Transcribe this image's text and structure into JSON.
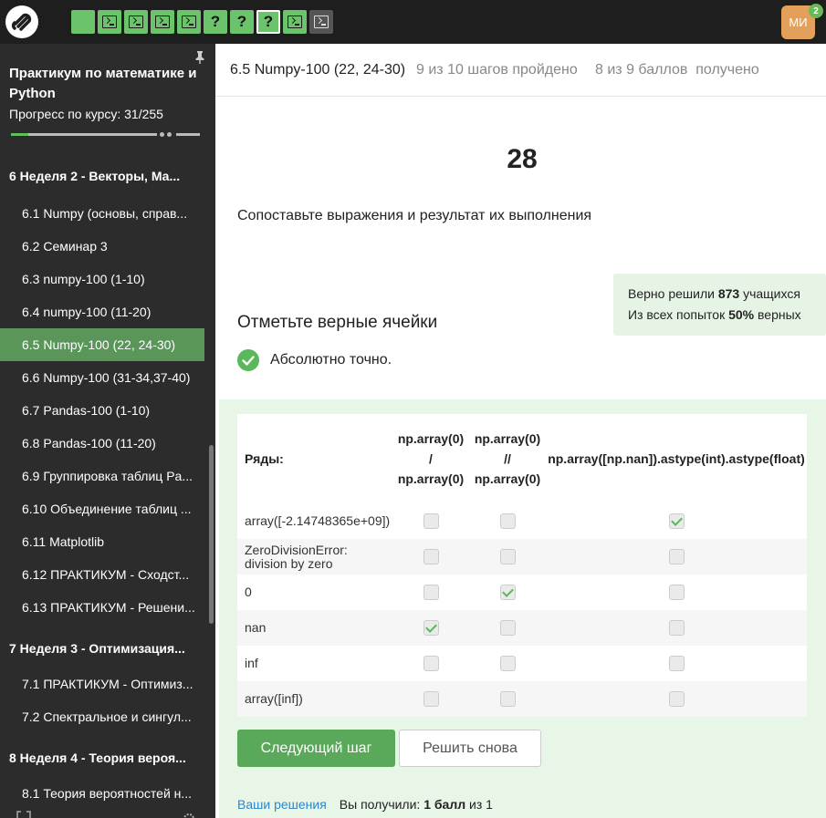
{
  "topbar": {
    "steps": [
      {
        "kind": "text",
        "state": "done",
        "glyph": ""
      },
      {
        "kind": "code",
        "state": "done",
        "glyph": ""
      },
      {
        "kind": "code",
        "state": "done",
        "glyph": ""
      },
      {
        "kind": "code",
        "state": "done",
        "glyph": ""
      },
      {
        "kind": "code",
        "state": "done",
        "glyph": ""
      },
      {
        "kind": "quiz",
        "state": "done",
        "glyph": "?"
      },
      {
        "kind": "quiz",
        "state": "done",
        "glyph": "?"
      },
      {
        "kind": "quiz",
        "state": "current",
        "glyph": "?"
      },
      {
        "kind": "code",
        "state": "done",
        "glyph": ""
      },
      {
        "kind": "code",
        "state": "pending",
        "glyph": ""
      }
    ],
    "avatar_initials": "МИ",
    "notification_count": "2",
    "colors": {
      "step_done": "#6bc36b",
      "step_pending": "#555555",
      "avatar": "#e3a05a"
    }
  },
  "sidebar": {
    "course_title": "Практикум по математике и Python",
    "progress_label": "Прогресс по курсу:  31/255",
    "progress_fraction": 0.1216,
    "sections": [
      {
        "title": "6  Неделя 2 - Векторы, Ма...",
        "items": [
          {
            "label": "6.1  Numpy (основы, справ..."
          },
          {
            "label": "6.2  Семинар 3"
          },
          {
            "label": "6.3  numpy-100 (1-10)"
          },
          {
            "label": "6.4  numpy-100 (11-20)"
          },
          {
            "label": "6.5  Numpy-100 (22, 24-30)",
            "active": true
          },
          {
            "label": "6.6  Numpy-100 (31-34,37-40)"
          },
          {
            "label": "6.7  Pandas-100 (1-10)"
          },
          {
            "label": "6.8  Pandas-100 (11-20)"
          },
          {
            "label": "6.9  Группировка таблиц Pa..."
          },
          {
            "label": "6.10  Объединение таблиц ..."
          },
          {
            "label": "6.11  Matplotlib"
          },
          {
            "label": "6.12  ПРАКТИКУМ - Сходст..."
          },
          {
            "label": "6.13  ПРАКТИКУМ - Решени..."
          }
        ]
      },
      {
        "title": "7  Неделя 3 - Оптимизация...",
        "items": [
          {
            "label": "7.1  ПРАКТИКУМ - Оптимиз..."
          },
          {
            "label": "7.2  Спектральное и сингул..."
          }
        ]
      },
      {
        "title": "8  Неделя 4 - Теория вероя...",
        "items": [
          {
            "label": "8.1  Теория вероятностей н..."
          }
        ]
      }
    ],
    "active_color": "#5a965a"
  },
  "header": {
    "lesson": "6.5 Numpy-100 (22, 24-30)",
    "steps_done": "9 из 10 шагов пройдено",
    "score": "8 из 9 баллов  получено"
  },
  "step": {
    "number": "28",
    "question": "Сопоставьте выражения и результат их выполнения",
    "stats": {
      "solved_prefix": "Верно решили ",
      "solved_count": "873",
      "solved_suffix": " учащихся",
      "attempts_prefix": "Из всех попыток ",
      "attempts_pct": "50%",
      "attempts_suffix": " верных"
    },
    "subtitle": "Отметьте верные ячейки",
    "verdict": "Абсолютно точно."
  },
  "matrix": {
    "row_header": "Ряды:",
    "columns": [
      {
        "lines": [
          "np.array(0)",
          "/",
          "np.array(0)"
        ]
      },
      {
        "lines": [
          "np.array(0)",
          "//",
          "np.array(0)"
        ]
      },
      {
        "lines": [
          "np.array([np.nan]).astype(int).astype(float)"
        ]
      }
    ],
    "rows": [
      {
        "label": "array([-2.14748365e+09])",
        "checks": [
          false,
          false,
          true
        ]
      },
      {
        "label": "ZeroDivisionError: division by zero",
        "checks": [
          false,
          false,
          false
        ]
      },
      {
        "label": "0",
        "checks": [
          false,
          true,
          false
        ]
      },
      {
        "label": "nan",
        "checks": [
          true,
          false,
          false
        ]
      },
      {
        "label": "inf",
        "checks": [
          false,
          false,
          false
        ]
      },
      {
        "label": "array([inf])",
        "checks": [
          false,
          false,
          false
        ]
      }
    ]
  },
  "actions": {
    "next_label": "Следующий шаг",
    "retry_label": "Решить снова"
  },
  "footer": {
    "solutions_link": "Ваши решения",
    "got_prefix": "Вы получили: ",
    "got_value": "1 балл",
    "got_suffix": " из 1"
  }
}
